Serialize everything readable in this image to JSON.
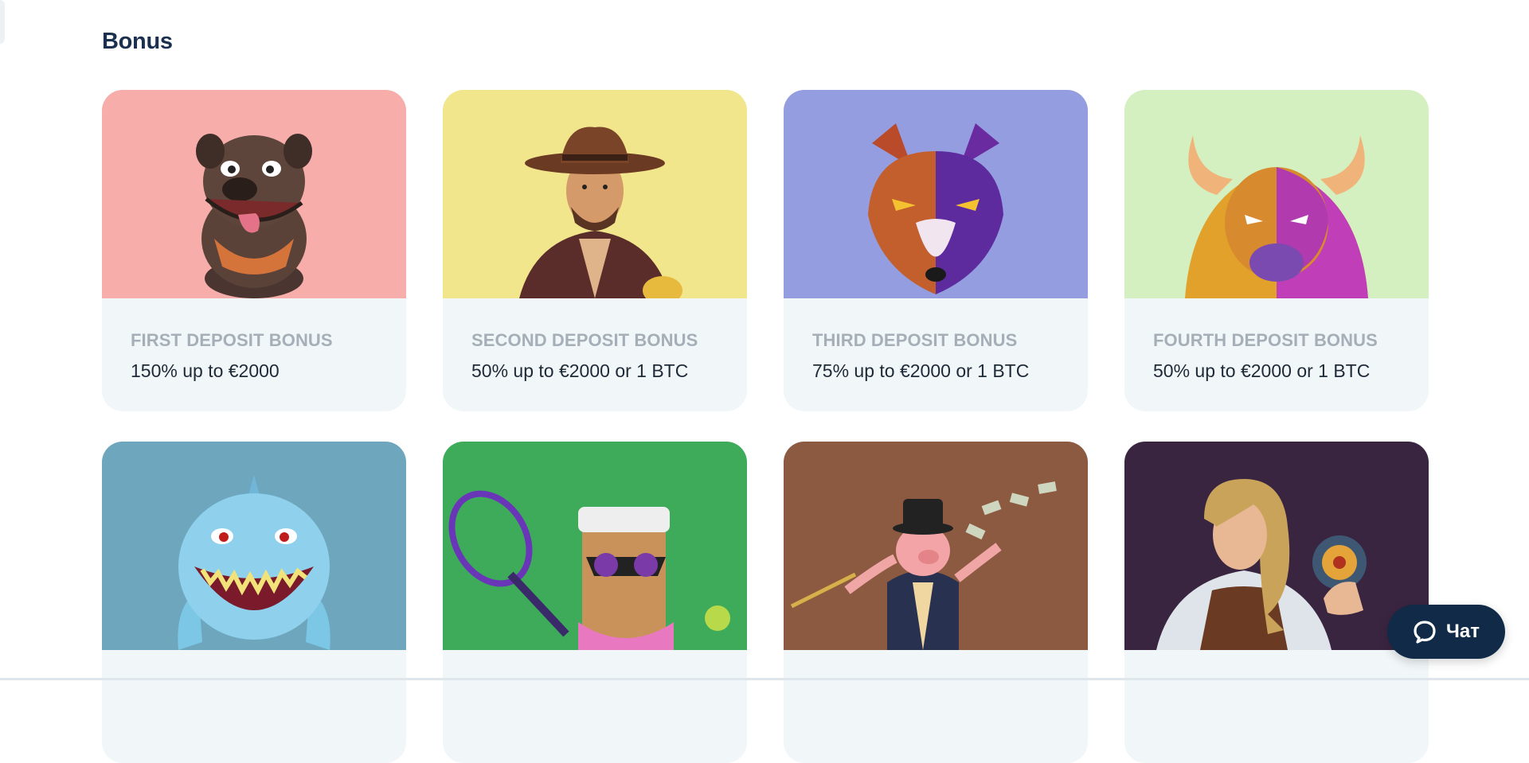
{
  "section": {
    "title": "Bonus"
  },
  "cards": [
    {
      "title": "FIRST DEPOSIT BONUS",
      "desc": "150% up to €2000",
      "bg": "#f7aeaa",
      "art": "dog-character"
    },
    {
      "title": "SECOND DEPOSIT BONUS",
      "desc": "50% up to €2000 or 1 BTC",
      "bg": "#f2e68d",
      "art": "cowboy-character"
    },
    {
      "title": "THIRD DEPOSIT BONUS",
      "desc": "75% up to €2000 or 1 BTC",
      "bg": "#949ddf",
      "art": "wolf-character"
    },
    {
      "title": "FOURTH DEPOSIT BONUS",
      "desc": "50% up to €2000 or 1 BTC",
      "bg": "#d4f0c0",
      "art": "bison-character"
    },
    {
      "title": "",
      "desc": "",
      "bg": "#6ea7bd",
      "art": "shark-character"
    },
    {
      "title": "",
      "desc": "",
      "bg": "#3eab5b",
      "art": "tiki-tennis-character"
    },
    {
      "title": "",
      "desc": "",
      "bg": "#8b5a41",
      "art": "pig-banker-character"
    },
    {
      "title": "",
      "desc": "",
      "bg": "#3a2540",
      "art": "adventurer-woman-character"
    }
  ],
  "chat": {
    "label": "Чат",
    "icon": "chat-bubble-icon"
  }
}
